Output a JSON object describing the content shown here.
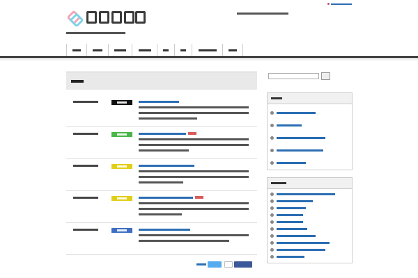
{
  "header": {
    "top_link": "",
    "site_name": "",
    "tagline": "",
    "header_note": ""
  },
  "nav": {
    "items": [
      "",
      "",
      "",
      "",
      "",
      "",
      "",
      ""
    ]
  },
  "main": {
    "heading": "",
    "posts": [
      {
        "date": "",
        "badge": "",
        "badge_color": "#111111",
        "title": "",
        "is_new": false
      },
      {
        "date": "",
        "badge": "",
        "badge_color": "#49b649",
        "title": "",
        "is_new": true
      },
      {
        "date": "",
        "badge": "",
        "badge_color": "#e0cf1a",
        "title": "",
        "is_new": false
      },
      {
        "date": "",
        "badge": "",
        "badge_color": "#e0cf1a",
        "title": "",
        "is_new": true
      },
      {
        "date": "",
        "badge": "",
        "badge_color": "#3f6fc4",
        "title": "",
        "is_new": false
      }
    ],
    "share_label": ""
  },
  "sidebar": {
    "search_placeholder": "",
    "widgets": [
      {
        "heading": "",
        "items": [
          "",
          "",
          "",
          "",
          ""
        ]
      },
      {
        "heading": "",
        "items": [
          "",
          "",
          "",
          "",
          "",
          "",
          "",
          "",
          "",
          ""
        ]
      }
    ]
  },
  "colors": {
    "link": "#2a6db3",
    "nav_rule": "#111111",
    "panel_bg": "#e9e9e9",
    "twitter": "#55acee",
    "facebook": "#3b5998"
  }
}
